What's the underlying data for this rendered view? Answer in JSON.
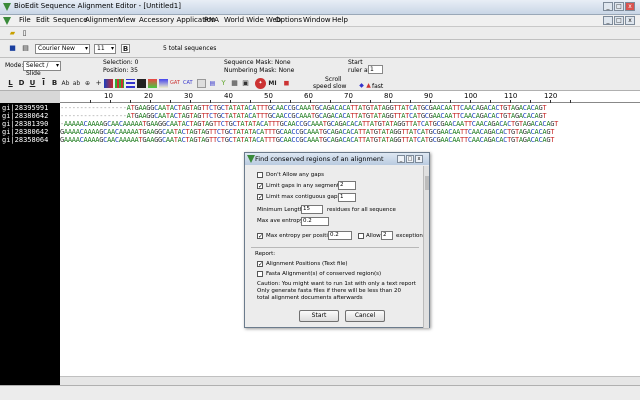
{
  "window": {
    "title": "BioEdit Sequence Alignment Editor - [Untitled1]"
  },
  "menu": [
    "File",
    "Edit",
    "Sequence",
    "Alignment",
    "View",
    "Accessory Application",
    "RNA",
    "World Wide Web",
    "Options",
    "Window",
    "Help"
  ],
  "toolbar": {
    "font": "Courier New",
    "font_size": "11",
    "bold_label": "B",
    "sequence_count": "5 total sequences",
    "mode_label": "Mode:",
    "mode_value": "Select / Slide",
    "selection": "Selection: 0",
    "position": "Position:  35",
    "sequence_mask": "Sequence Mask: None",
    "numbering_mask": "Numbering Mask: None",
    "start_ruler_label1": "Start",
    "start_ruler_label2": "ruler at",
    "start_ruler_value": "1",
    "scroll_label": "Scroll",
    "speed_label": "speed  slow",
    "fast_label": "fast"
  },
  "ruler": [
    "10",
    "20",
    "30",
    "40",
    "50",
    "60",
    "70",
    "80",
    "90",
    "100",
    "110",
    "120"
  ],
  "sequences": [
    {
      "name": "gi|28395991",
      "seq": "-----------------ATGAAGGCAATACTAGTAGTTCTGCTATATACATTTGCAACCGCAAATGCAGACACATTATGTATAGGTTATCATGCGAACAATTCAACAGACACTGTAGACACAGT"
    },
    {
      "name": "gi|28380642",
      "seq": "-----------------ATGAAGGCAATACTAGTAGTTCTGCTATATACATTTGCAACCGCAAATGCAGACACATTATGTATAGGTTATCATGCGAACAATTCAACAGACACTGTAGACACAGT"
    },
    {
      "name": "gi|28381390",
      "seq": "-AAAAACAAAAGCAACAAAAATGAAGGCAATACTAGTAGTTCTGCTATATACATTTGCAACCGCAAATGCAGACACATTATGTATAGGTTATCATGCGAACAATTCAACAGACACTGTAGACACAGT"
    },
    {
      "name": "gi|28380642",
      "seq": "GAAAACAAAAGCAACAAAAATGAAGGCAATACTAGTAGTTCTGCTATATACATTTGCAACCGCAAATGCAGACACATTATGTATAGGTTATCATGCGAACAATTCAACAGACACTGTAGACACAGT"
    },
    {
      "name": "gi|28358064",
      "seq": "GAAAACAAAAGCAACAAAAATGAAGGCAATACTAGTAGTTCTGCTATATACATTTGCAACCGCAAATGCAGACACATTATGTATAGGTTATCATGCGAACAATTCAACAGACACTGTAGACACAGT"
    }
  ],
  "base_colors": {
    "A": "#1a7a1a",
    "C": "#1a3fbf",
    "G": "#333333",
    "T": "#c62828",
    "-": "#999999"
  },
  "dialog": {
    "title": "Find conserved regions of an alignment",
    "dont_allow_gaps": "Don't Allow any gaps",
    "limit_gaps": "Limit gaps in any segment to:",
    "limit_gaps_value": "2",
    "limit_contiguous": "Limit max contiguous gaps to:",
    "limit_contiguous_value": "1",
    "min_length_label": "Minimum Length:",
    "min_length_value": "15",
    "min_length_suffix": "residues for all sequence",
    "max_ave_entropy_label": "Max ave entropy",
    "max_ave_entropy_value": "0.2",
    "max_entropy_label": "Max entropy per position:",
    "max_entropy_value": "0.2",
    "allow_label": "Allow",
    "allow_value": "2",
    "exceptions_label": "exception",
    "report_label": "Report:",
    "alignment_positions": "Alignment Positions (Text file)",
    "fasta_alignments": "Fasta Alignment(s) of conserved region(s)",
    "caution": "Caution: You might want to run 1st with only a text report",
    "only_generate": "Only generate fasta files if there will be less than 20",
    "total_docs": "total alignment documents afterwards",
    "start_button": "Start",
    "cancel_button": "Cancel"
  }
}
